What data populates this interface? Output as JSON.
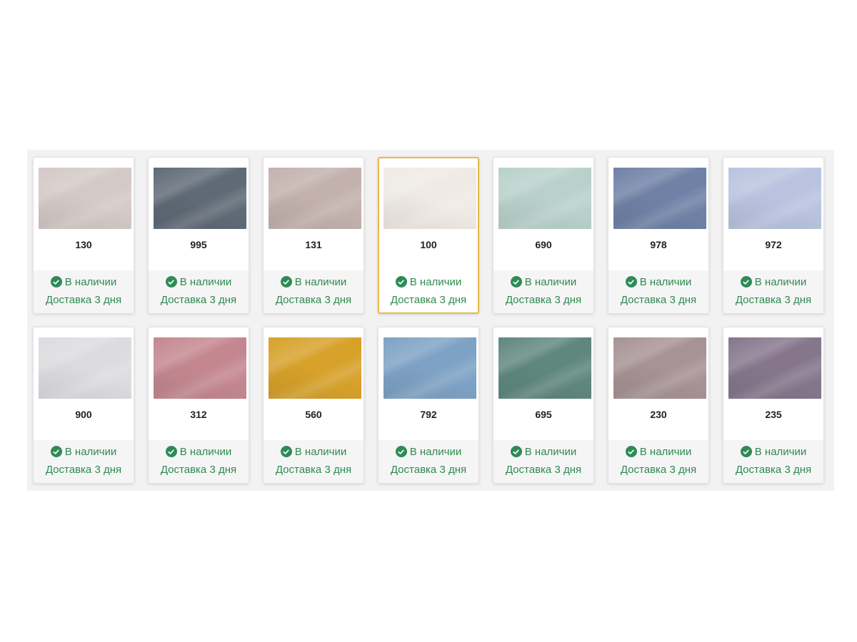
{
  "cards": [
    {
      "code": "130",
      "color": "#d3c9c6",
      "stock": "В наличии",
      "delivery": "Доставка 3 дня"
    },
    {
      "code": "995",
      "color": "#5f6a76",
      "stock": "В наличии",
      "delivery": "Доставка 3 дня"
    },
    {
      "code": "131",
      "color": "#c3b1ad",
      "stock": "В наличии",
      "delivery": "Доставка 3 дня"
    },
    {
      "code": "100",
      "color": "#efeae4",
      "stock": "В наличии",
      "delivery": "Доставка 3 дня",
      "selected": true
    },
    {
      "code": "690",
      "color": "#b9d1cb",
      "stock": "В наличии",
      "delivery": "Доставка 3 дня"
    },
    {
      "code": "978",
      "color": "#6f81a6",
      "stock": "В наличии",
      "delivery": "Доставка 3 дня"
    },
    {
      "code": "972",
      "color": "#b9c3df",
      "stock": "В наличии",
      "delivery": "Доставка 3 дня"
    },
    {
      "code": "900",
      "color": "#dcdce0",
      "stock": "В наличии",
      "delivery": "Доставка 3 дня"
    },
    {
      "code": "312",
      "color": "#c48790",
      "stock": "В наличии",
      "delivery": "Доставка 3 дня"
    },
    {
      "code": "560",
      "color": "#d7a12a",
      "stock": "В наличии",
      "delivery": "Доставка 3 дня"
    },
    {
      "code": "792",
      "color": "#7ea2c5",
      "stock": "В наличии",
      "delivery": "Доставка 3 дня"
    },
    {
      "code": "695",
      "color": "#5f877d",
      "stock": "В наличии",
      "delivery": "Доставка 3 дня"
    },
    {
      "code": "230",
      "color": "#a79295",
      "stock": "В наличии",
      "delivery": "Доставка 3 дня"
    },
    {
      "code": "235",
      "color": "#85768c",
      "stock": "В наличии",
      "delivery": "Доставка 3 дня"
    }
  ],
  "colors": {
    "status_green": "#2e8b57",
    "selected_border": "#e8b84a"
  },
  "icons": {
    "status": "check-circle-icon"
  }
}
